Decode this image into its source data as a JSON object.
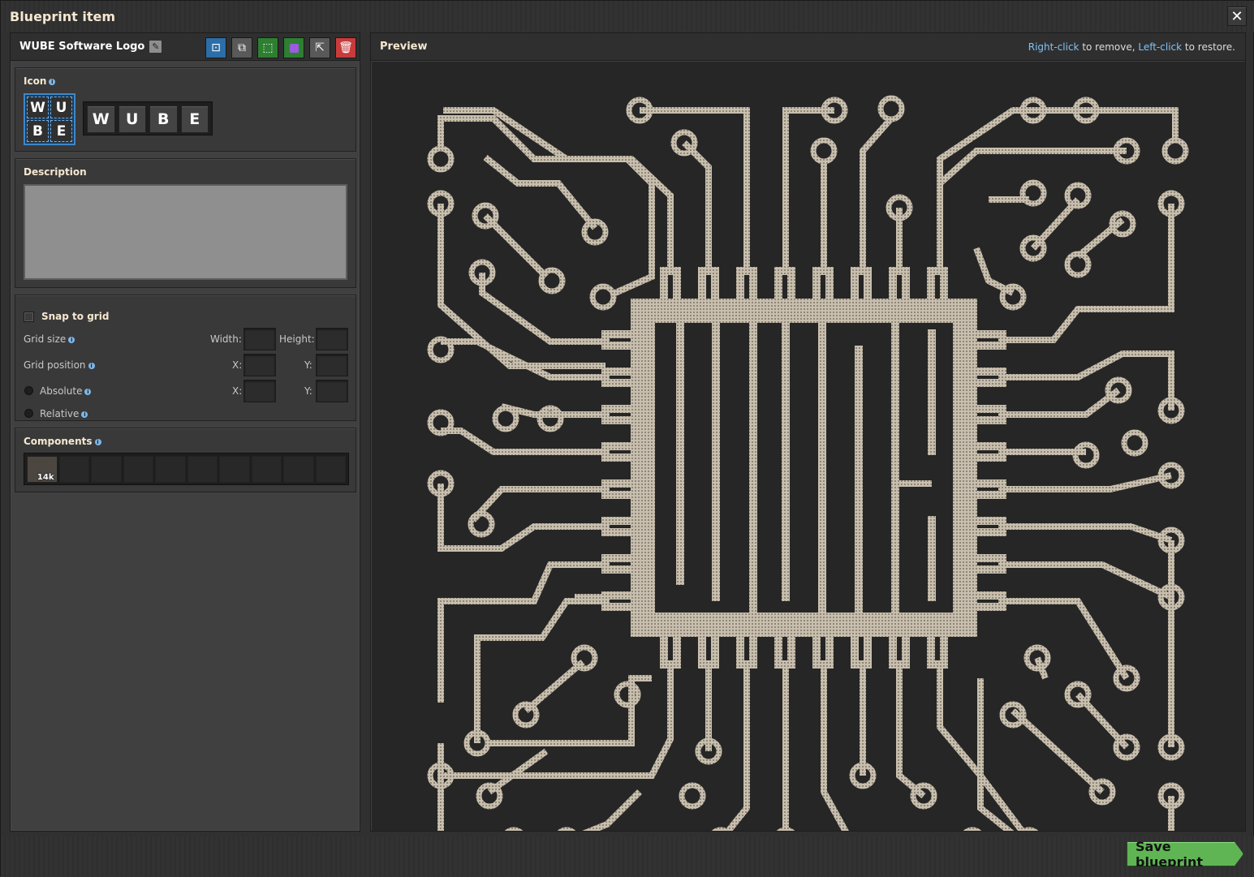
{
  "window": {
    "title": "Blueprint item",
    "close_glyph": "✕"
  },
  "blueprint": {
    "name": "WUBE Software Logo",
    "toolbar": [
      {
        "name": "select-area-icon",
        "color": "#2c6ea8"
      },
      {
        "name": "copy-icon",
        "color": "#5a595a"
      },
      {
        "name": "reselect-icon",
        "color": "#2e7f31"
      },
      {
        "name": "purple-gem-icon",
        "color": "#2e7f31"
      },
      {
        "name": "export-icon",
        "color": "#5a595a"
      },
      {
        "name": "trash-icon",
        "color": "#c93b3b"
      }
    ]
  },
  "icon": {
    "title": "Icon",
    "letters": [
      "W",
      "U",
      "B",
      "E"
    ],
    "slots": [
      "W",
      "U",
      "B",
      "E"
    ]
  },
  "description": {
    "title": "Description",
    "value": ""
  },
  "grid": {
    "snap_label": "Snap to grid",
    "size_label": "Grid size",
    "width_label": "Width:",
    "height_label": "Height:",
    "position_label": "Grid position",
    "x_label": "X:",
    "y_label": "Y:",
    "absolute_label": "Absolute",
    "relative_label": "Relative"
  },
  "components": {
    "title": "Components",
    "count": "14k"
  },
  "preview": {
    "title": "Preview",
    "hint_right": "Right-click",
    "hint_mid": " to remove, ",
    "hint_left": "Left-click",
    "hint_end": " to restore."
  },
  "footer": {
    "save_label": "Save blueprint"
  },
  "colors": {
    "trace": "#c9bfae",
    "background": "#262626",
    "accent": "#5fb554"
  }
}
